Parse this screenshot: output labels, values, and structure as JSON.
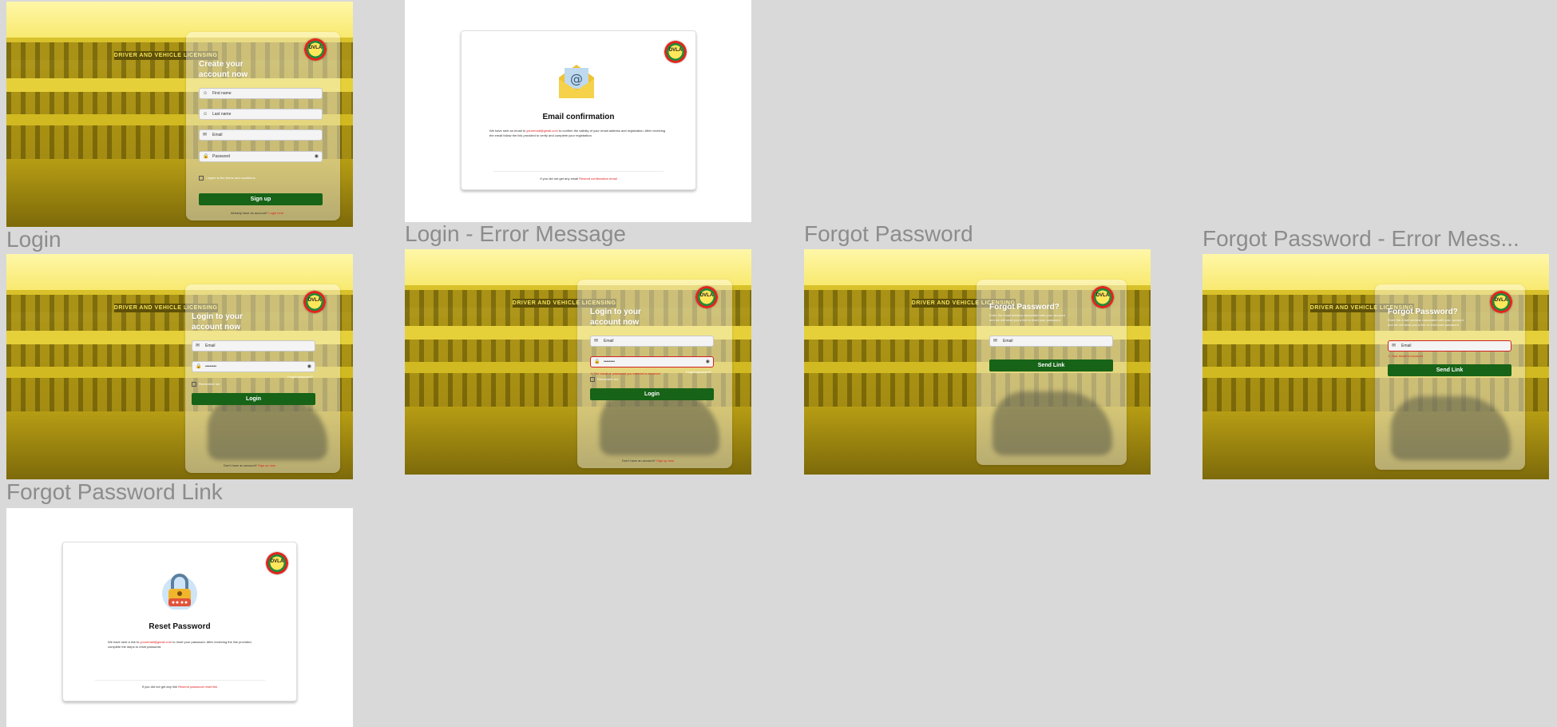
{
  "frames": {
    "signup": {
      "title": "",
      "heading": "Create your account now",
      "first_name": "First name",
      "last_name": "Last name",
      "email": "Email",
      "password": "Password",
      "terms": "I agree to the terms and conditions",
      "button": "Sign up",
      "footer_text": "Already have an account?",
      "footer_link": "Login here"
    },
    "email_confirm": {
      "title": "",
      "heading": "Email confirmation",
      "body_pre": "We have sent an email to",
      "body_email": "youremail@gmail.com",
      "body_post": "to confirm the validity of your email address and registration. After receiving the email follow the link provided to verify and complete your registration.",
      "footer_text": "If you did not get any email",
      "footer_link": "Resend confirmation email"
    },
    "login": {
      "title": "Login",
      "heading": "Login to your account now",
      "email": "Email",
      "password": "••••••••",
      "forgot": "Forgot password?",
      "remember": "Remember me",
      "button": "Login",
      "footer_text": "Don't have an account?",
      "footer_link": "Sign up now"
    },
    "login_error": {
      "title": "Login - Error Message",
      "heading": "Login to your account now",
      "email": "Email",
      "password": "••••••••",
      "forgot": "Forgot password?",
      "error": "The email or password you entered is incorrect",
      "remember": "Remember me",
      "button": "Login",
      "footer_text": "Don't have an account?",
      "footer_link": "Sign up now"
    },
    "forgot": {
      "title": "Forgot Password",
      "heading": "Forgot Password?",
      "sub": "Enter the email address associated with your account and we will send you a link to reset your password",
      "email": "Email",
      "button": "Send Link"
    },
    "forgot_error": {
      "title": "Forgot Password -  Error Mess...",
      "heading": "Forgot Password?",
      "sub": "Enter the email address associated with your account and we will send you a link to reset your password",
      "email": "Email",
      "error": "Your email is incorrect",
      "button": "Send Link"
    },
    "forgot_link": {
      "title": "Forgot Password Link",
      "heading": "Reset Password",
      "body_pre": "We have sent a link to",
      "body_email": "youremail@gmail.com",
      "body_post": "to reset your password. After receiving the link provided, complete the steps to reset password.",
      "footer_text": "If you did not get any link",
      "footer_link": "Resend password reset link"
    }
  },
  "logo_text": "DVLA",
  "building_sign": "DRIVER AND VEHICLE LICENSING",
  "colors": {
    "accent_green": "#176317",
    "error_red": "#e01e1e",
    "photo_yellow": "#e8cf2b"
  },
  "icons": [
    "user-icon",
    "mail-icon",
    "lock-icon",
    "eye-icon",
    "envelope-icon",
    "padlock-icon",
    "dvla-logo"
  ]
}
